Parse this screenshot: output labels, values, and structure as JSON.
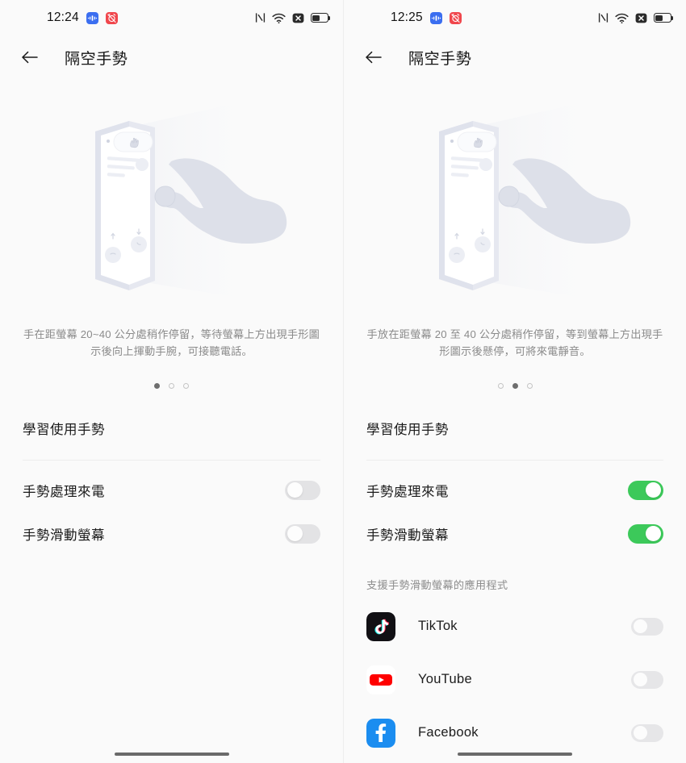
{
  "left": {
    "statusbar": {
      "time": "12:24",
      "app_icons": [
        "bluetooth-audio-icon",
        "alarm-off-icon"
      ],
      "right_icons": [
        "nfc-icon",
        "wifi-icon",
        "mute-icon",
        "battery-icon"
      ],
      "battery_level": 45
    },
    "header": {
      "back": "back-arrow-icon",
      "title": "隔空手勢"
    },
    "illustration": "air-gesture-answer-call-illustration",
    "description": "手在距螢幕 20~40 公分處稍作停留，等待螢幕上方出現手形圖示後向上揮動手腕，可接聽電話。",
    "dots": {
      "count": 3,
      "active": 0
    },
    "learn_row": {
      "label": "學習使用手勢"
    },
    "settings": [
      {
        "label": "手勢處理來電",
        "on": false
      },
      {
        "label": "手勢滑動螢幕",
        "on": false
      }
    ]
  },
  "right": {
    "statusbar": {
      "time": "12:25",
      "app_icons": [
        "bluetooth-audio-icon",
        "alarm-off-icon"
      ],
      "right_icons": [
        "nfc-icon",
        "wifi-icon",
        "mute-icon",
        "battery-icon"
      ],
      "battery_level": 45
    },
    "header": {
      "back": "back-arrow-icon",
      "title": "隔空手勢"
    },
    "illustration": "air-gesture-mute-call-illustration",
    "description": "手放在距螢幕 20 至 40 公分處稍作停留，等到螢幕上方出現手形圖示後懸停，可將來電靜音。",
    "dots": {
      "count": 3,
      "active": 1
    },
    "learn_row": {
      "label": "學習使用手勢"
    },
    "settings": [
      {
        "label": "手勢處理來電",
        "on": true
      },
      {
        "label": "手勢滑動螢幕",
        "on": true
      }
    ],
    "apps_section_title": "支援手勢滑動螢幕的應用程式",
    "apps": [
      {
        "name": "TikTok",
        "icon": "tiktok-icon",
        "on": false
      },
      {
        "name": "YouTube",
        "icon": "youtube-icon",
        "on": false
      },
      {
        "name": "Facebook",
        "icon": "facebook-icon",
        "on": false
      }
    ]
  },
  "colors": {
    "toggle_on": "#3cc95a",
    "toggle_off": "#e3e3e5",
    "background": "#fafafa",
    "text_primary": "#1b1b1b",
    "text_secondary": "#8b8b8b"
  }
}
